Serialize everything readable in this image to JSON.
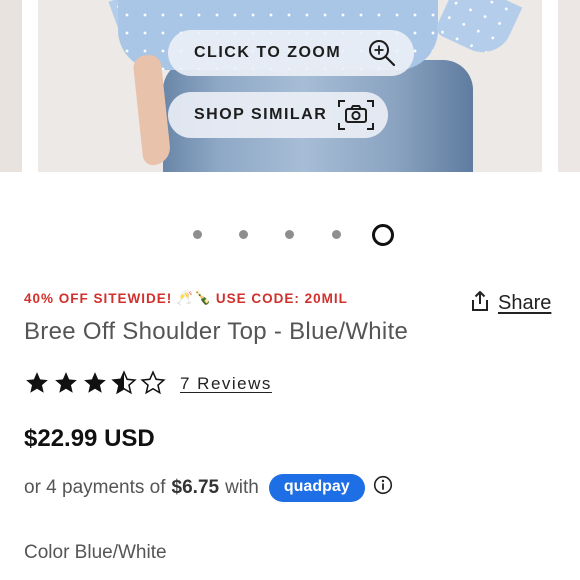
{
  "hero": {
    "zoom_label": "CLICK TO ZOOM",
    "zoom_icon": "magnify-plus-icon",
    "similar_label": "SHOP SIMILAR",
    "similar_icon": "camera-icon"
  },
  "carousel": {
    "count": 5,
    "active_index": 4
  },
  "promo": {
    "text_before": "40% OFF SITEWIDE!",
    "emoji": "🥂🍾",
    "text_after": "USE CODE: 20MIL",
    "color": "#d0312d"
  },
  "share": {
    "label": "Share",
    "icon": "share-icon"
  },
  "product": {
    "title": "Bree Off Shoulder Top - Blue/White",
    "rating": 3.5,
    "rating_max": 5,
    "reviews_label": "7 Reviews",
    "price": "$22.99 USD"
  },
  "installments": {
    "prefix": "or 4 payments of",
    "amount": "$6.75",
    "suffix": "with",
    "badge": "quadpay",
    "badge_color": "#1e6ee6",
    "info_icon": "info-icon"
  },
  "color": {
    "label": "Color Blue/White"
  }
}
